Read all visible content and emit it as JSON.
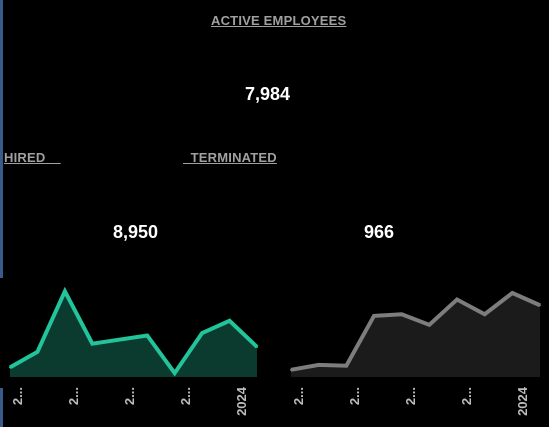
{
  "header": {
    "title": "ACTIVE EMPLOYEES"
  },
  "active": {
    "value": "7,984"
  },
  "hired": {
    "label": "HIRED    ",
    "value": "8,950"
  },
  "terminated": {
    "label": "  TERMINATED",
    "value": "966"
  },
  "colors": {
    "hired_line": "#21c49b",
    "hired_fill": "#0b3a2e",
    "term_line": "#7d7d7d",
    "term_fill": "#1b1b1b"
  },
  "chart_data": [
    {
      "type": "area",
      "series": [
        {
          "values": [
            3,
            22,
            96,
            32,
            37,
            42,
            -4,
            45,
            60,
            28
          ]
        }
      ],
      "x_tick_labels": [
        "2...",
        "2...",
        "2...",
        "2...",
        "2024"
      ],
      "ylim": [
        -10,
        105
      ]
    },
    {
      "type": "area",
      "series": [
        {
          "values": [
            0,
            6,
            5,
            66,
            68,
            55,
            86,
            68,
            94,
            79
          ]
        }
      ],
      "x_tick_labels": [
        "2...",
        "2...",
        "2...",
        "2...",
        "2024"
      ],
      "ylim": [
        -10,
        105
      ]
    }
  ]
}
